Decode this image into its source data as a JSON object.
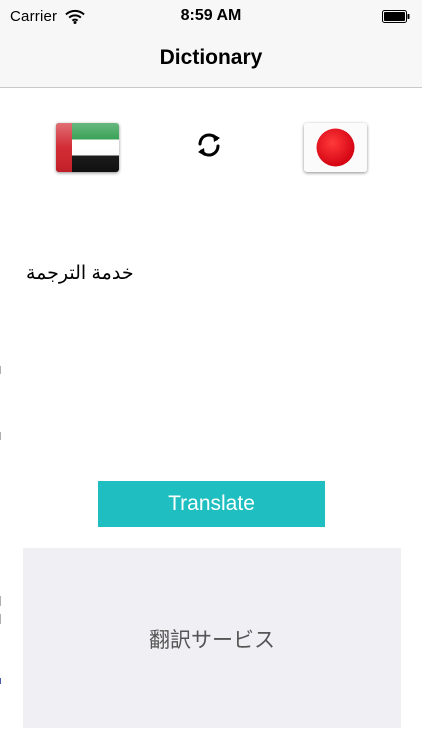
{
  "status_bar": {
    "carrier": "Carrier",
    "time": "8:59 AM"
  },
  "nav": {
    "title": "Dictionary"
  },
  "languages": {
    "source_flag": "uae-flag-icon",
    "target_flag": "japan-flag-icon",
    "swap_icon": "swap-refresh-icon"
  },
  "input": {
    "text": "خدمة الترجمة"
  },
  "translate_button": {
    "label": "Translate"
  },
  "result": {
    "text": "翻訳サービス"
  },
  "colors": {
    "accent": "#1fbfc1",
    "result_bg": "#efeff4",
    "bar_bg": "#f7f7f7",
    "uae_red": "#d0212a",
    "uae_green": "#17923a",
    "japan_red": "#e60012"
  }
}
